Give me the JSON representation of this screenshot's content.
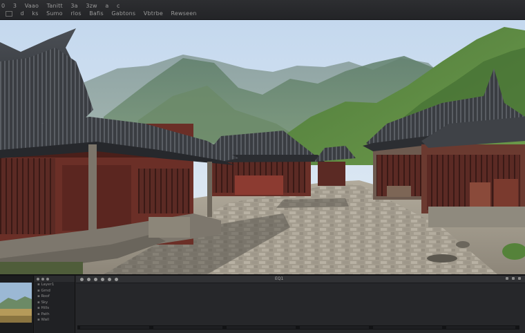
{
  "menubar": {
    "row1": [
      "0",
      "3",
      "Vaao",
      "Tanitt",
      "3a",
      "3zw",
      "a",
      "c"
    ],
    "row2": [
      "d",
      "ks",
      "Sumo",
      "rlos",
      "Bafis",
      "Gabtons",
      "Vbtrbe",
      "Rewseen"
    ]
  },
  "timeline": {
    "title": "EQ1"
  },
  "layers": {
    "items": [
      "Layer1",
      "Grnd",
      "Roof",
      "Sky",
      "Hills",
      "Path",
      "Wall"
    ]
  },
  "colors": {
    "accent": "#5a7fa6",
    "panel_bg": "#242528",
    "menubar_bg": "#2a2b2e"
  }
}
